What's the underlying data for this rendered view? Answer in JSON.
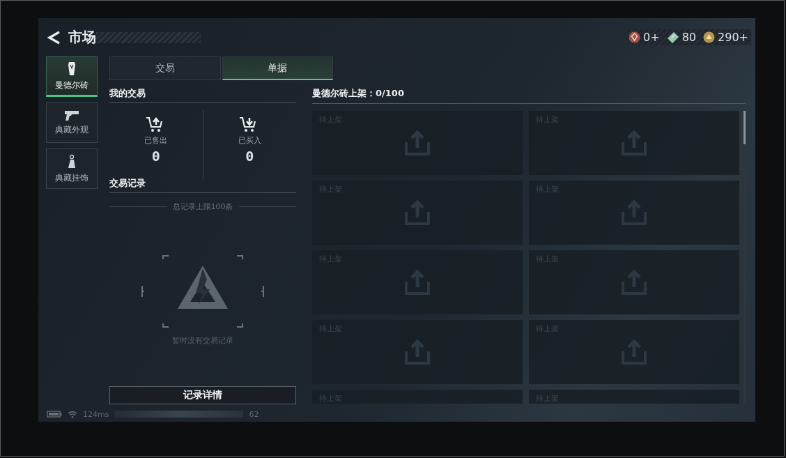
{
  "header": {
    "title": "市场",
    "currencies": [
      {
        "kind": "medal",
        "value": "0+"
      },
      {
        "kind": "ticket",
        "value": "80"
      },
      {
        "kind": "coin",
        "value": "290+"
      }
    ]
  },
  "sidebar": {
    "items": [
      {
        "kind": "brick",
        "label": "曼德尔砖",
        "selected": true
      },
      {
        "kind": "gun",
        "label": "典藏外观",
        "selected": false
      },
      {
        "kind": "charm",
        "label": "典藏挂饰",
        "selected": false
      }
    ]
  },
  "tabs": [
    {
      "label": "交易",
      "selected": false
    },
    {
      "label": "单据",
      "selected": true
    }
  ],
  "my_trades": {
    "heading": "我的交易",
    "stats": [
      {
        "kind": "sold",
        "label": "已售出",
        "value": "0"
      },
      {
        "kind": "bought",
        "label": "已买入",
        "value": "0"
      }
    ]
  },
  "records": {
    "heading": "交易记录",
    "limit_note": "总记录上限100条",
    "empty_text": "暂时没有交易记录",
    "details_button": "记录详情"
  },
  "listings": {
    "title": "曼德尔砖上架：0/100",
    "slots": [
      {
        "label": "待上架"
      },
      {
        "label": "待上架"
      },
      {
        "label": "待上架"
      },
      {
        "label": "待上架"
      },
      {
        "label": "待上架"
      },
      {
        "label": "待上架"
      },
      {
        "label": "待上架"
      },
      {
        "label": "待上架"
      },
      {
        "label": "待上架",
        "kind": "partial"
      },
      {
        "label": "待上架",
        "kind": "partial"
      }
    ]
  },
  "status_bar": {
    "ping": "124ms",
    "value": "62"
  }
}
